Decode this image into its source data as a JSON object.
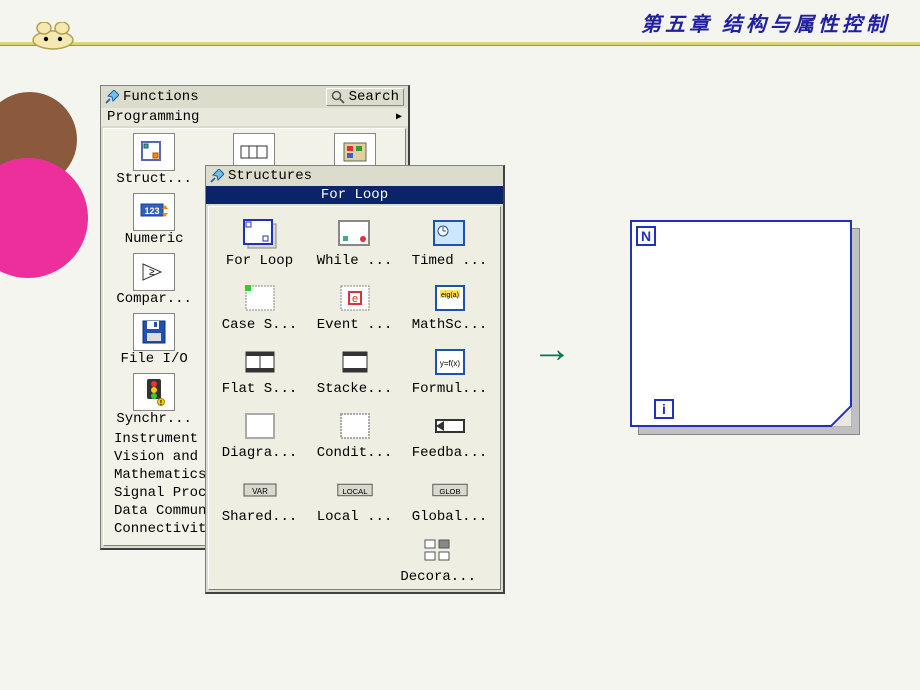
{
  "chapter": {
    "title": "第五章  结构与属性控制"
  },
  "functions_palette": {
    "title": "Functions",
    "search_label": "Search",
    "breadcrumb": "Programming",
    "items": [
      {
        "label": "Struct..."
      },
      {
        "label": ""
      },
      {
        "label": ""
      },
      {
        "label": "Numeric"
      },
      {
        "label": ""
      },
      {
        "label": ""
      },
      {
        "label": "Compar..."
      },
      {
        "label": ""
      },
      {
        "label": ""
      },
      {
        "label": "File I/O"
      },
      {
        "label": ""
      },
      {
        "label": ""
      },
      {
        "label": "Synchr..."
      },
      {
        "label": ""
      },
      {
        "label": ""
      }
    ],
    "categories": [
      "Instrument I",
      "Vision and M",
      "Mathematics",
      "Signal Proce",
      "Data Communi",
      "Connectivity"
    ]
  },
  "structures_palette": {
    "title": "Structures",
    "selected": "For Loop",
    "items": [
      {
        "label": "For Loop"
      },
      {
        "label": "While ..."
      },
      {
        "label": "Timed ..."
      },
      {
        "label": "Case S..."
      },
      {
        "label": "Event ..."
      },
      {
        "label": "MathSc..."
      },
      {
        "label": "Flat S..."
      },
      {
        "label": "Stacke..."
      },
      {
        "label": "Formul..."
      },
      {
        "label": "Diagra..."
      },
      {
        "label": "Condit..."
      },
      {
        "label": "Feedba..."
      },
      {
        "label": "Shared..."
      },
      {
        "label": "Local ..."
      },
      {
        "label": "Global..."
      }
    ],
    "decor_label": "Decora...",
    "var_badge": "VAR",
    "local_badge": "LOCAL",
    "glob_badge": "GLOB"
  },
  "forloop": {
    "n": "N",
    "i": "i"
  }
}
